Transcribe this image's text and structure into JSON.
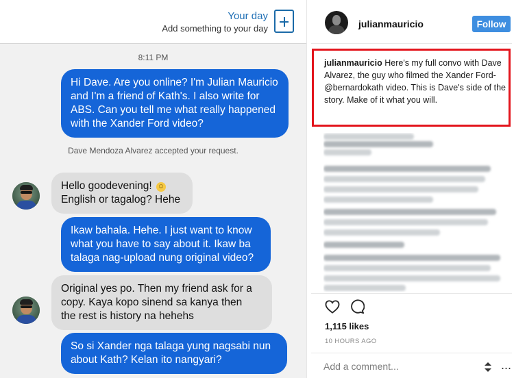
{
  "messenger": {
    "your_day": {
      "title": "Your day",
      "subtitle": "Add something to your day",
      "icon": "plus-icon"
    },
    "timestamp": "8:11 PM",
    "system_message": "Dave Mendoza Alvarez accepted your request.",
    "messages": [
      {
        "direction": "outgoing",
        "lines": [
          "Hi Dave. Are you online? I'm Julian Mauricio",
          "and I'm a friend of Kath's. I also write for",
          "ABS. Can you tell me what really happened",
          "with the Xander Ford video?"
        ]
      },
      {
        "direction": "incoming",
        "lines": [
          "Hello goodevening!",
          "English or tagalog?  Hehe"
        ]
      },
      {
        "direction": "outgoing",
        "lines": [
          "Ikaw bahala. Hehe. I just want to know",
          "what you have to say about it. Ikaw ba",
          "talaga nag-upload nung original video?"
        ]
      },
      {
        "direction": "incoming",
        "lines": [
          "Original yes po.  Then my friend ask for a",
          "copy.  Kaya kopo sinend sa kanya then",
          "the rest is history na hehehs"
        ]
      },
      {
        "direction": "outgoing",
        "lines": [
          "So si Xander nga talaga yung nagsabi nun",
          "about Kath? Kelan ito nangyari?"
        ]
      }
    ],
    "emoji": "☺"
  },
  "post": {
    "username": "julianmauricio",
    "follow_label": "Follow",
    "caption": {
      "username": "julianmauricio",
      "text": " Here's my full convo with Dave Alvarez, the guy who filmed the Xander Ford-@bernardokath video. This is Dave's side of the story. Make of it what you will."
    },
    "likes": "1,115 likes",
    "time_ago": "10 HOURS AGO",
    "comment_placeholder": "Add a comment...",
    "ellipsis": "...",
    "icons": [
      "heart-icon",
      "comment-icon",
      "updown-arrows-icon",
      "more-options-icon"
    ],
    "highlight_color": "#e3141c",
    "follow_color": "#3e8ee0"
  }
}
